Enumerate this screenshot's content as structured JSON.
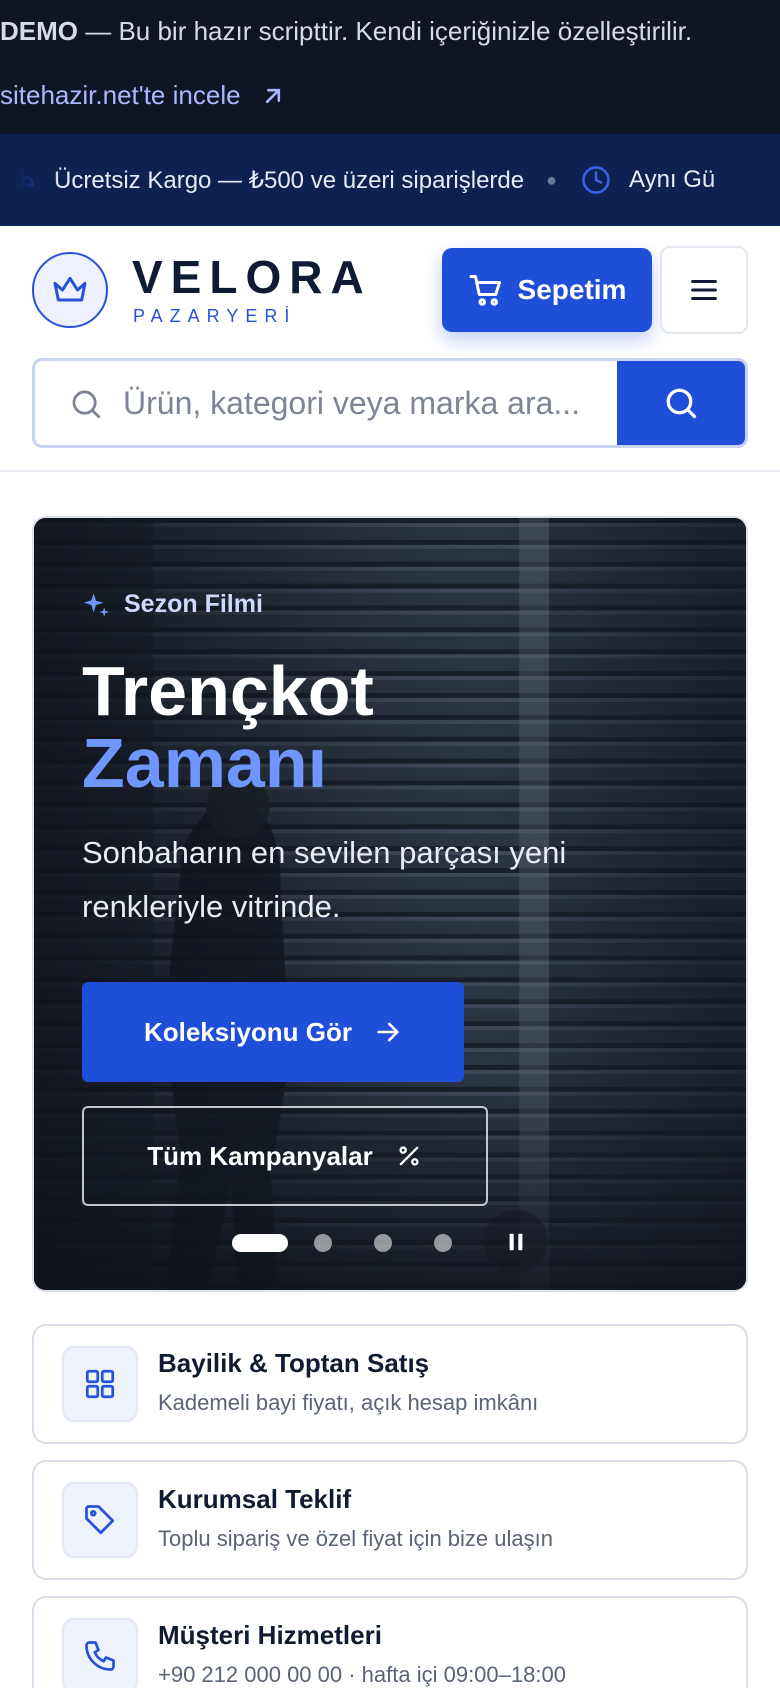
{
  "demo": {
    "label": "DEMO",
    "text": " — Bu bir hazır scripttir. Kendi içeriğinizle özelleştirilir.",
    "link": "sitehazir.net'te incele"
  },
  "announcement": {
    "items": [
      "Ücretsiz Kargo — ₺500 ve üzeri siparişlerde",
      "Aynı Gü"
    ]
  },
  "header": {
    "brand": "VELORA",
    "brand_sub": "PAZARYERİ",
    "cart_label": "Sepetim",
    "search_placeholder": "Ürün, kategori veya marka ara..."
  },
  "hero": {
    "eyebrow": "Sezon Filmi",
    "title_line1": "Trençkot",
    "title_line2": "Zamanı",
    "description": "Sonbaharın en sevilen parçası yeni renkleriyle vitrinde.",
    "primary_cta": "Koleksiyonu Gör",
    "secondary_cta": "Tüm Kampanyalar",
    "slide_count": 4,
    "active_slide": 1
  },
  "info_cards": [
    {
      "title": "Bayilik & Toptan Satış",
      "subtitle": "Kademeli bayi fiyatı, açık hesap imkânı",
      "icon": "grid-icon"
    },
    {
      "title": "Kurumsal Teklif",
      "subtitle": "Toplu sipariş ve özel fiyat için bize ulaşın",
      "icon": "tag-icon"
    },
    {
      "title": "Müşteri Hizmetleri",
      "subtitle": "+90 212 000 00 00 · hafta içi 09:00–18:00",
      "icon": "phone-icon"
    }
  ],
  "colors": {
    "primary": "#1f4fd8",
    "dark_bar": "#0f1524",
    "announcement_bar": "#0d2152",
    "accent_text": "#6f95ff"
  }
}
